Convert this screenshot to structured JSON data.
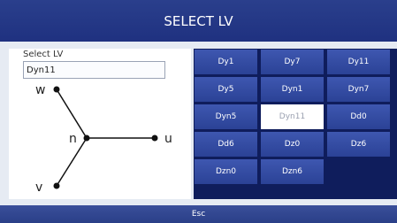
{
  "header": {
    "title": "SELECT LV"
  },
  "form": {
    "label": "Select LV",
    "value": "Dyn11"
  },
  "diagram": {
    "labels": {
      "w": "w",
      "n": "n",
      "u": "u",
      "v": "v"
    }
  },
  "vector_groups": [
    {
      "label": "Dy1",
      "selected": false
    },
    {
      "label": "Dy7",
      "selected": false
    },
    {
      "label": "Dy11",
      "selected": false
    },
    {
      "label": "Dy5",
      "selected": false
    },
    {
      "label": "Dyn1",
      "selected": false
    },
    {
      "label": "Dyn7",
      "selected": false
    },
    {
      "label": "Dyn5",
      "selected": false
    },
    {
      "label": "Dyn11",
      "selected": true
    },
    {
      "label": "Dd0",
      "selected": false
    },
    {
      "label": "Dd6",
      "selected": false
    },
    {
      "label": "Dz0",
      "selected": false
    },
    {
      "label": "Dz6",
      "selected": false
    },
    {
      "label": "Dzn0",
      "selected": false
    },
    {
      "label": "Dzn6",
      "selected": false
    }
  ],
  "footer": {
    "esc_label": "Esc"
  },
  "colors": {
    "header_bg": "#1f3180",
    "button_bg": "#3048a0",
    "selected_bg": "#ffffff",
    "selected_text": "#9aa0b0",
    "grid_bg": "#0f1d5c"
  }
}
